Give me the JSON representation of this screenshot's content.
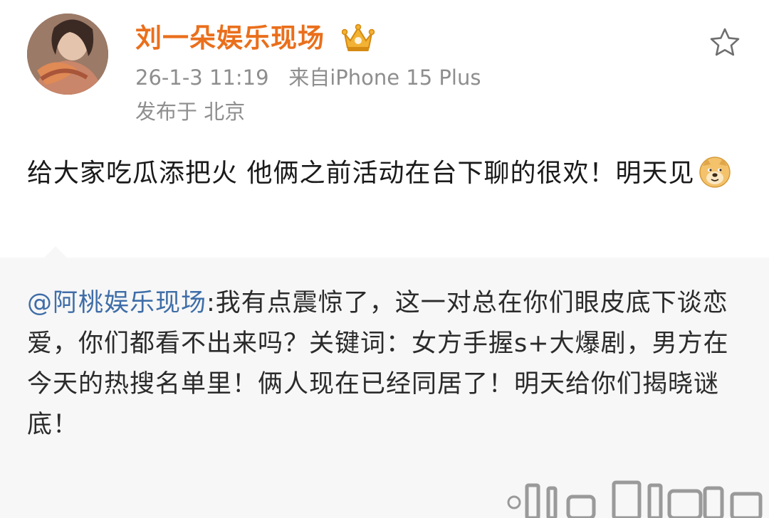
{
  "post": {
    "username": "刘一朵娱乐现场",
    "timestamp": "26-1-3 11:19",
    "source": "来自iPhone 15 Plus",
    "location": "发布于 北京",
    "text": "给大家吃瓜添把火 他俩之前活动在台下聊的很欢！明天见",
    "emoji_icon": "doge-emoji-icon",
    "badge_icon": "crown-badge-icon",
    "favorite_icon": "star-outline-icon"
  },
  "repost": {
    "mention": "@阿桃娱乐现场",
    "text": ":我有点震惊了，这一对总在你们眼皮底下谈恋爱，你们都看不出来吗？关键词：女方手握s+大爆剧，男方在今天的热搜名单里！俩人现在已经同居了！明天给你们揭晓谜底！"
  },
  "colors": {
    "username": "#ea6f1c",
    "meta": "#8e8e8e",
    "mention": "#3f6ea8",
    "repost_bg": "#f7f7f7"
  }
}
